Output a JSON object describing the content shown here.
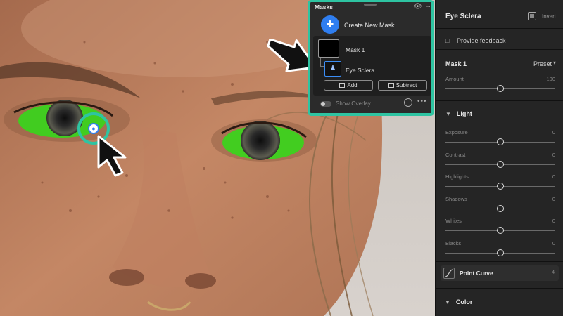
{
  "masks_panel": {
    "title": "Masks",
    "create_label": "Create New Mask",
    "create_icon": "+",
    "mask1_label": "Mask 1",
    "sclera_label": "Eye Sclera",
    "add_label": "Add",
    "subtract_label": "Subtract",
    "overlay_label": "Show Overlay",
    "more_label": "•••",
    "eye_icon": "👁",
    "arrow_icon": "→"
  },
  "right_panel": {
    "title": "Eye Sclera",
    "invert_label": "Invert",
    "feedback_label": "Provide feedback",
    "mask_name": "Mask 1",
    "preset_label": "Preset",
    "amount": {
      "label": "Amount",
      "value": "100",
      "level": 0.5
    },
    "light_label": "Light",
    "sliders": [
      {
        "label": "Exposure",
        "value": "0",
        "level": 0.5
      },
      {
        "label": "Contrast",
        "value": "0",
        "level": 0.5
      },
      {
        "label": "Highlights",
        "value": "0",
        "level": 0.5
      },
      {
        "label": "Shadows",
        "value": "0",
        "level": 0.5
      },
      {
        "label": "Whites",
        "value": "0",
        "level": 0.5
      },
      {
        "label": "Blacks",
        "value": "0",
        "level": 0.5
      }
    ],
    "point_curve_label": "Point Curve",
    "point_curve_value": "4",
    "color_label": "Color"
  },
  "colors": {
    "accent_teal": "#2ec4a2",
    "accent_blue": "#2f7ef0",
    "mask_green": "#3cd21e"
  }
}
